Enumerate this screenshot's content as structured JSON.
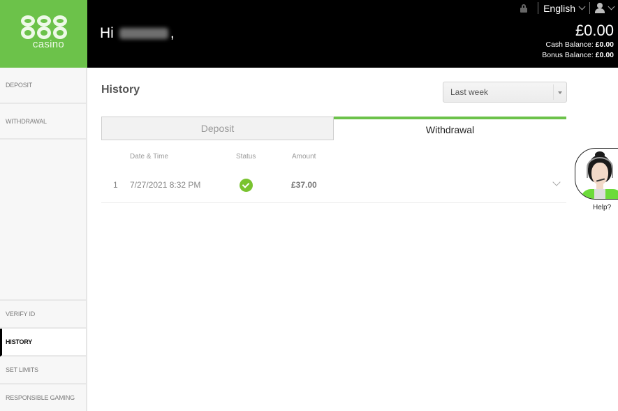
{
  "brand": {
    "logo_number": "888",
    "logo_text": "casino",
    "colors": {
      "brand_green": "#6cc24a",
      "header_bg": "#000000",
      "status_ok": "#79c32f"
    }
  },
  "header": {
    "greeting_prefix": "Hi",
    "greeting_suffix": ",",
    "language": "English",
    "icons": {
      "lock": "lock-icon",
      "user": "user-icon"
    },
    "balance_total": "£0.00",
    "cash_balance_label": "Cash Balance:",
    "cash_balance_value": "£0.00",
    "bonus_balance_label": "Bonus Balance:",
    "bonus_balance_value": "£0.00"
  },
  "sidebar": {
    "items": [
      {
        "label": "DEPOSIT",
        "active": false
      },
      {
        "label": "WITHDRAWAL",
        "active": false
      },
      {
        "label": "VERIFY ID",
        "active": false
      },
      {
        "label": "HISTORY",
        "active": true
      },
      {
        "label": "SET LIMITS",
        "active": false
      },
      {
        "label": "RESPONSIBLE GAMING",
        "active": false
      }
    ]
  },
  "main": {
    "title": "History",
    "period_select": {
      "selected": "Last week"
    },
    "tabs": [
      {
        "label": "Deposit",
        "active": false
      },
      {
        "label": "Withdrawal",
        "active": true
      }
    ],
    "table": {
      "columns": [
        "Date & Time",
        "Status",
        "Amount"
      ],
      "rows": [
        {
          "index": "1",
          "datetime": "7/27/2021 8:32 PM",
          "status": "completed",
          "amount": "£37.00"
        }
      ]
    }
  },
  "help_widget": {
    "label": "Help?"
  }
}
